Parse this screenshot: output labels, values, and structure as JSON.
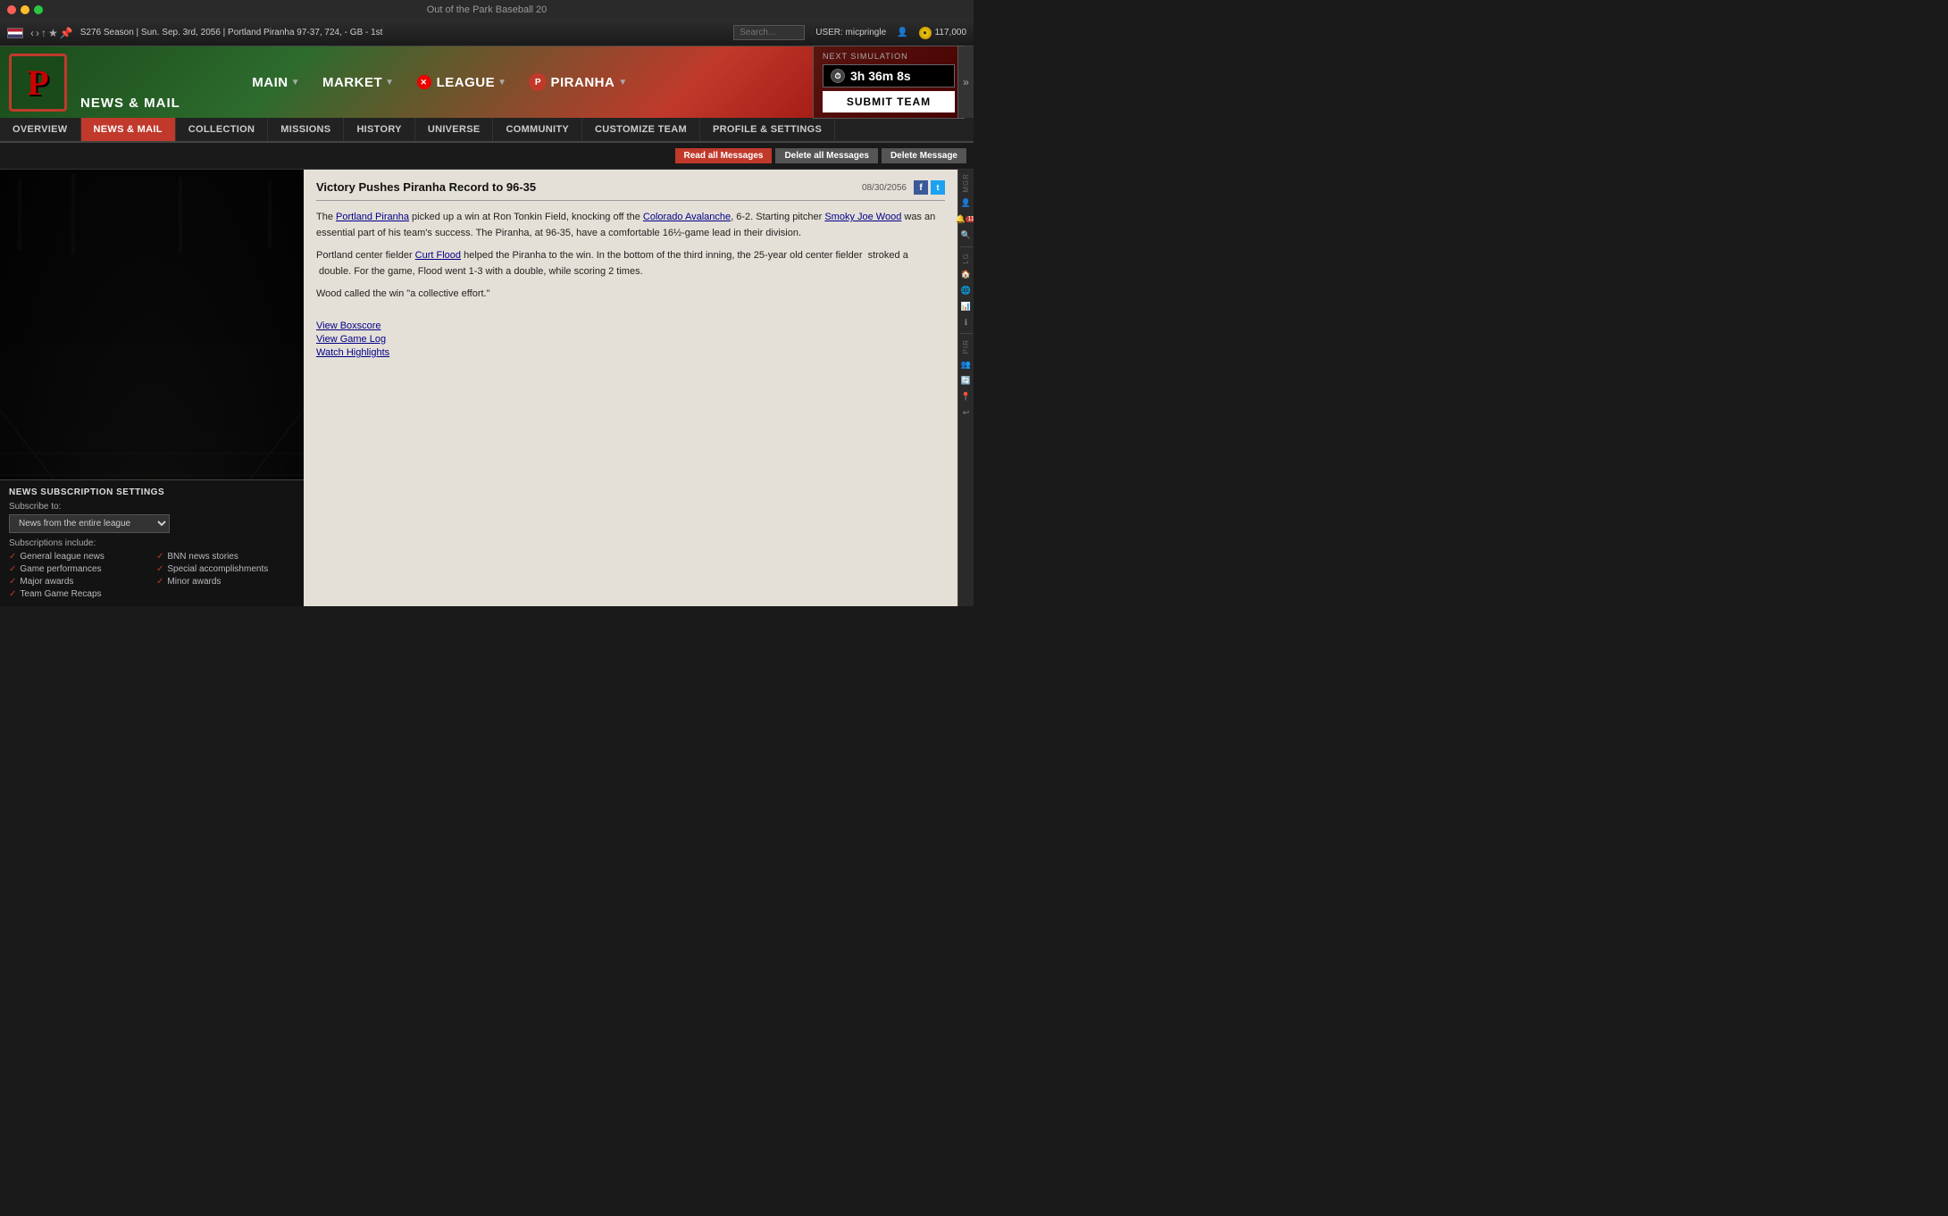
{
  "window": {
    "title": "Out of the Park Baseball 20"
  },
  "top_nav": {
    "season_info": "S276 Season  |  Sun. Sep. 3rd, 2056  |  Portland Piranha  97-37, 724, - GB - 1st",
    "user": "USER: micpringle",
    "currency": "117,000",
    "search_placeholder": "Search..."
  },
  "main_nav": {
    "items": [
      {
        "label": "MAIN",
        "has_dropdown": true
      },
      {
        "label": "MARKET",
        "has_dropdown": true
      },
      {
        "label": "LEAGUE",
        "has_dropdown": true
      },
      {
        "label": "PIRANHA",
        "has_dropdown": true
      }
    ],
    "team_name": "PIRANHA"
  },
  "next_sim": {
    "label": "NEXT SIMULATION",
    "timer": "3h 36m 8s",
    "submit_btn": "SUBMIT TEAM"
  },
  "second_nav": {
    "items": [
      {
        "label": "OVERVIEW",
        "active": false
      },
      {
        "label": "NEWS & MAIL",
        "active": true
      },
      {
        "label": "COLLECTION",
        "active": false
      },
      {
        "label": "MISSIONS",
        "active": false
      },
      {
        "label": "HISTORY",
        "active": false
      },
      {
        "label": "UNIVERSE",
        "active": false
      },
      {
        "label": "COMMUNITY",
        "active": false
      },
      {
        "label": "CUSTOMIZE TEAM",
        "active": false
      },
      {
        "label": "PROFILE & SETTINGS",
        "active": false
      }
    ]
  },
  "news_actions": {
    "read_all": "Read all Messages",
    "delete_all": "Delete all Messages",
    "delete": "Delete Message"
  },
  "article": {
    "title": "Victory Pushes Piranha Record to 96-35",
    "date": "08/30/2056",
    "body1": "The Portland Piranha picked up a win at Ron Tonkin Field, knocking off the Colorado Avalanche, 6-2. Starting pitcher Smoky Joe Wood was an essential part of his team's success. The Piranha, at 96-35, have a comfortable 16½-game lead in their division.",
    "body2": "Portland center fielder Curt Flood helped the Piranha to the win. In the bottom of the third inning, the 25-year old center fielder  stroked a  double. For the game, Flood went 1-3 with a double, while scoring 2 times.",
    "body3": "Wood called the win \"a collective effort.\"",
    "links": {
      "view_boxscore": "View Boxscore",
      "view_game_log": "View Game Log",
      "watch_highlights": "Watch Highlights"
    },
    "underlined_team1": "Portland Piranha",
    "underlined_opponent": "Colorado Avalanche",
    "underlined_pitcher": "Smoky Joe Wood",
    "underlined_fielder": "Curt Flood"
  },
  "subscription": {
    "title": "NEWS SUBSCRIPTION SETTINGS",
    "subscribe_label": "Subscribe to:",
    "dropdown_value": "News from the entire league",
    "includes_label": "Subscriptions include:",
    "checkboxes_left": [
      "General league news",
      "Game performances",
      "Major awards",
      "Team Game Recaps"
    ],
    "checkboxes_right": [
      "BNN news stories",
      "Special accomplishments",
      "Minor awards"
    ]
  },
  "right_sidebar": {
    "labels": [
      "MGR",
      "LG",
      "PIR"
    ],
    "badge_count": "11"
  },
  "icons": {
    "flag": "🇺🇸",
    "coin": "●",
    "timer": "⏱",
    "facebook": "f",
    "twitter": "t",
    "search": "🔍",
    "arrow_left": "‹",
    "arrow_right": "›",
    "star": "★",
    "bookmark": "🔖",
    "settings": "⚙",
    "person": "👤",
    "mail": "✉",
    "chart": "📊",
    "shield": "🛡",
    "trade": "🔄",
    "location": "📍",
    "back": "↩",
    "expand": "»",
    "home": "🏠",
    "bell": "🔔",
    "team": "👥",
    "history": "📋"
  }
}
